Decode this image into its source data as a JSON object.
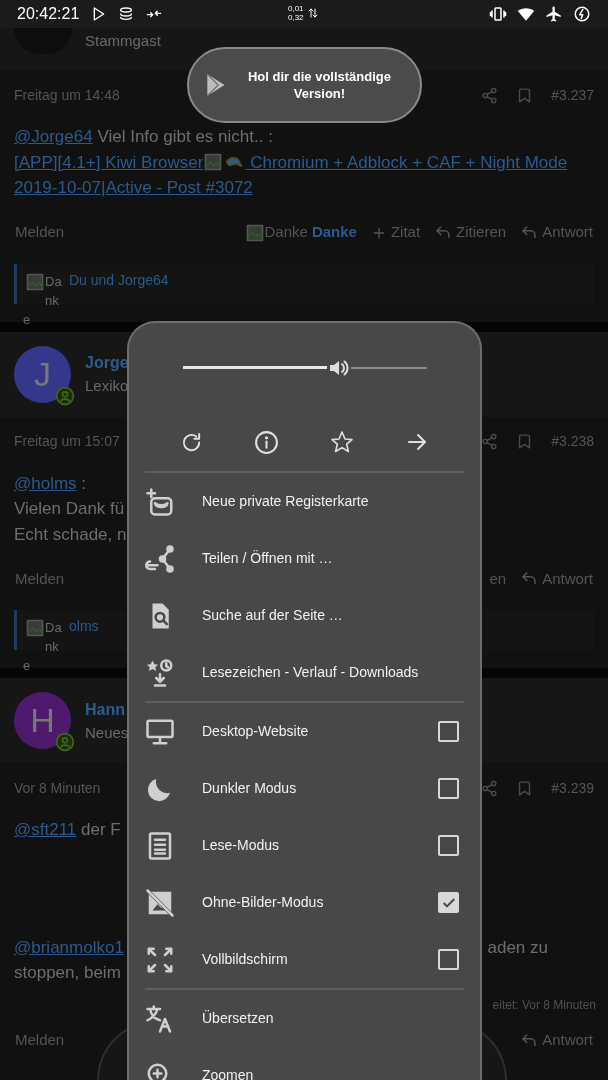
{
  "status_bar": {
    "time": "20:42:21",
    "net_up": "0,01",
    "net_down": "0,32"
  },
  "top_user": {
    "role": "Stammgast"
  },
  "toast": {
    "text": "Hol dir die vollständige Version!"
  },
  "posts": [
    {
      "date": "Freitag um 14:48",
      "number": "#3.237",
      "lines": [
        [
          {
            "kind": "link",
            "text": "@Jorge64"
          },
          {
            "kind": "text",
            "text": " Viel Info gibt es nicht.. :"
          }
        ],
        [
          {
            "kind": "link",
            "text": "[APP][4.1+] Kiwi Browser"
          },
          {
            "kind": "image"
          },
          {
            "kind": "bird"
          },
          {
            "kind": "link",
            "text": " Chromium + Adblock + CAF + Night Mode"
          }
        ],
        [
          {
            "kind": "link",
            "text": "2019-10-07|Active - Post #3072"
          }
        ]
      ],
      "actions": {
        "report": "Melden",
        "thanks_alt": "Danke",
        "thanks": "Danke",
        "quote": "Zitat",
        "cite": "Zitieren",
        "reply": "Antwort"
      },
      "reactions": {
        "alt": [
          "Da",
          "nk",
          "e"
        ],
        "text": "Du und Jorge64"
      }
    },
    {
      "user": {
        "initial": "J",
        "color": "#34378a",
        "name": "Jorge",
        "role": "Lexiko"
      },
      "date": "Freitag um 15:07",
      "number": "#3.238",
      "lines": [
        [
          {
            "kind": "link",
            "text": "@holms"
          },
          {
            "kind": "text",
            "text": " :"
          }
        ],
        [
          {
            "kind": "text",
            "text": "Vielen Dank fü"
          }
        ],
        [
          {
            "kind": "text",
            "text": "Echt schade, n"
          }
        ]
      ],
      "actions": {
        "report": "Melden",
        "cite": "en",
        "reply": "Antwort"
      },
      "reactions": {
        "alt": [
          "Da",
          "nk",
          "e"
        ],
        "text": "olms"
      }
    },
    {
      "user": {
        "initial": "H",
        "color": "#4f1a6e",
        "name": "Hann",
        "role": "Neues"
      },
      "date": "Vor 8 Minuten",
      "number": "#3.239",
      "lines": [
        [
          {
            "kind": "link",
            "text": "@sft211"
          },
          {
            "kind": "text",
            "text": " der F"
          }
        ],
        [
          {
            "kind": "link",
            "text": "@brianmolko1"
          }
        ],
        [
          {
            "kind": "text",
            "text": "stoppen, beim"
          }
        ]
      ],
      "right_fragment": "aden zu",
      "edited": "eitet: Vor 8 Minuten",
      "actions": {
        "report": "Melden",
        "reply": "Antwort"
      }
    }
  ],
  "menu": {
    "volume": {
      "level": 0.6
    },
    "sections": [
      [
        {
          "kind": "action",
          "label": "Neue private Registerkarte"
        },
        {
          "kind": "action",
          "label": "Teilen / Öffnen mit …"
        },
        {
          "kind": "action",
          "label": "Suche auf der Seite …"
        },
        {
          "kind": "action",
          "label": "Lesezeichen - Verlauf - Downloads"
        }
      ],
      [
        {
          "kind": "toggle",
          "label": "Desktop-Website",
          "checked": false
        },
        {
          "kind": "toggle",
          "label": "Dunkler Modus",
          "checked": false
        },
        {
          "kind": "toggle",
          "label": "Lese-Modus",
          "checked": false
        },
        {
          "kind": "toggle",
          "label": "Ohne-Bilder-Modus",
          "checked": true
        },
        {
          "kind": "toggle",
          "label": "Vollbildschirm",
          "checked": false
        }
      ],
      [
        {
          "kind": "action",
          "label": "Übersetzen"
        },
        {
          "kind": "action",
          "label": "Zoomen"
        }
      ]
    ]
  }
}
